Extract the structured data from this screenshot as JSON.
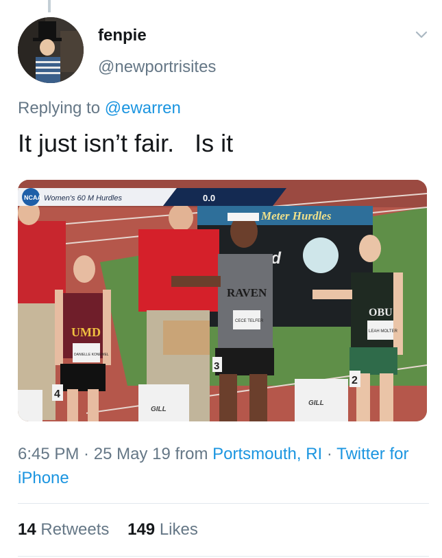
{
  "user": {
    "display_name": "fenpie",
    "handle": "@newportrisites",
    "avatar_icon": "avatar-photo"
  },
  "menu_icon": "chevron-down-icon",
  "reply": {
    "prefix": "Replying to",
    "mention": "@ewarren"
  },
  "tweet": {
    "text": "It just isn’t fair.   Is it"
  },
  "media": {
    "scoreboard_label": "Women's 60 M Hurdles",
    "scoreboard_time": "0.0",
    "screen_banner": "Meter Hurdles",
    "screen_word": "ood",
    "jersey_left": "UMD",
    "bib_left": "DANIELLE KONEWEL",
    "jersey_center": "RAVEN",
    "bib_center": "CECE TELFER",
    "jersey_right": "OBU",
    "bib_right": "LEAH MOLTER",
    "lane_left": "4",
    "lane_center": "3",
    "lane_right": "2",
    "block_brand_left": "GILL",
    "block_brand_right": "GILL",
    "ncaa_logo": "NCAA"
  },
  "meta": {
    "time": "6:45 PM",
    "sep1": " · ",
    "date": "25 May 19",
    "from": " from ",
    "location": "Portsmouth, RI",
    "sep2": " · ",
    "source": "Twitter for iPhone"
  },
  "stats": {
    "retweets_count": "14",
    "retweets_label": "Retweets",
    "likes_count": "149",
    "likes_label": "Likes"
  },
  "colors": {
    "link": "#1b95e0",
    "secondary": "#657786",
    "primary": "#14171a"
  }
}
